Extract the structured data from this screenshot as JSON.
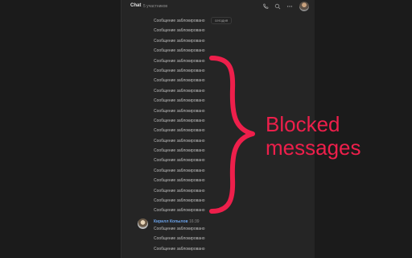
{
  "header": {
    "title": "Chat",
    "subtitle": "5 участников",
    "icons": [
      "phone-icon",
      "search-icon",
      "more-icon",
      "avatar"
    ]
  },
  "date_pill": "сегодня",
  "blocked_messages": [
    "Сообщение заблокировано",
    "Сообщение заблокировано",
    "Сообщение заблокировано",
    "Сообщение заблокировано",
    "Сообщение заблокировано",
    "Сообщение заблокировано",
    "Сообщение заблокировано",
    "Сообщение заблокировано",
    "Сообщение заблокировано",
    "Сообщение заблокировано",
    "Сообщение заблокировано",
    "Сообщение заблокировано",
    "Сообщение заблокировано",
    "Сообщение заблокировано",
    "Сообщение заблокировано",
    "Сообщение заблокировано",
    "Сообщение заблокировано",
    "Сообщение заблокировано",
    "Сообщение заблокировано",
    "Сообщение заблокировано"
  ],
  "sender": {
    "name": "Кирилл Копылов",
    "time": "16:39",
    "messages": [
      "Сообщение заблокировано",
      "Сообщение заблокировано",
      "Сообщение заблокировано"
    ]
  },
  "annotation": {
    "text": "Blocked\nmessages",
    "color": "#ee1f4b"
  }
}
